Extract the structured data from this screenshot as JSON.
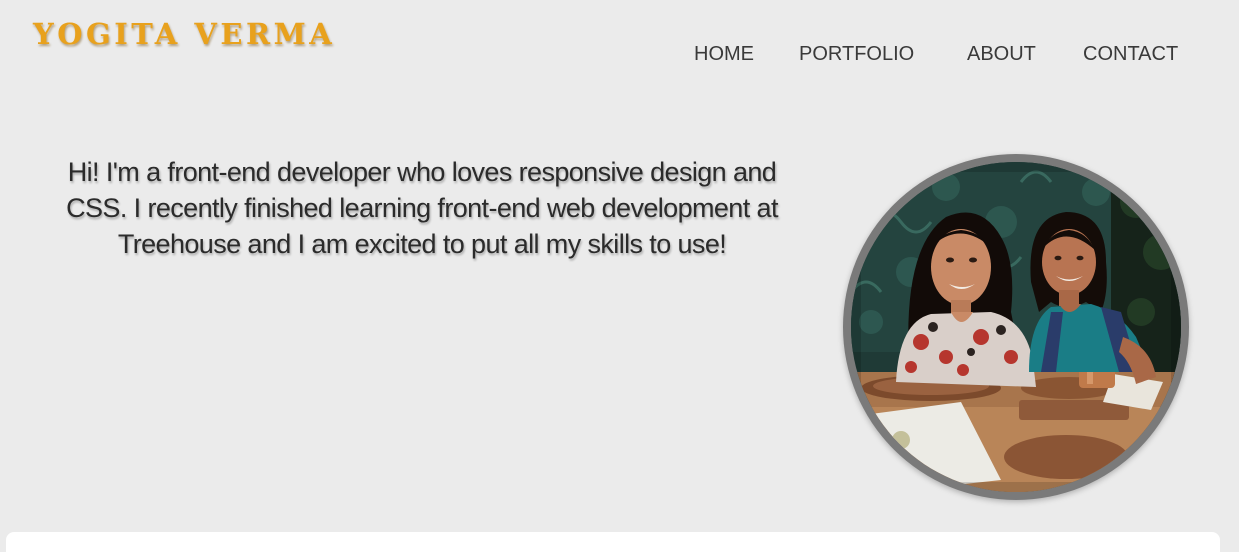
{
  "header": {
    "logo_text": "YOGITA VERMA",
    "logo_color": "#e8a11d"
  },
  "nav": {
    "items": [
      {
        "label": "HOME"
      },
      {
        "label": "PORTFOLIO"
      },
      {
        "label": "ABOUT"
      },
      {
        "label": "CONTACT"
      }
    ]
  },
  "main": {
    "intro_text": "Hi! I'm a front-end developer who loves responsive design and CSS. I recently finished learning front-end web development at Treehouse and I am excited to put all my skills to use!"
  },
  "profile": {
    "border_color": "#7a7a7a"
  }
}
